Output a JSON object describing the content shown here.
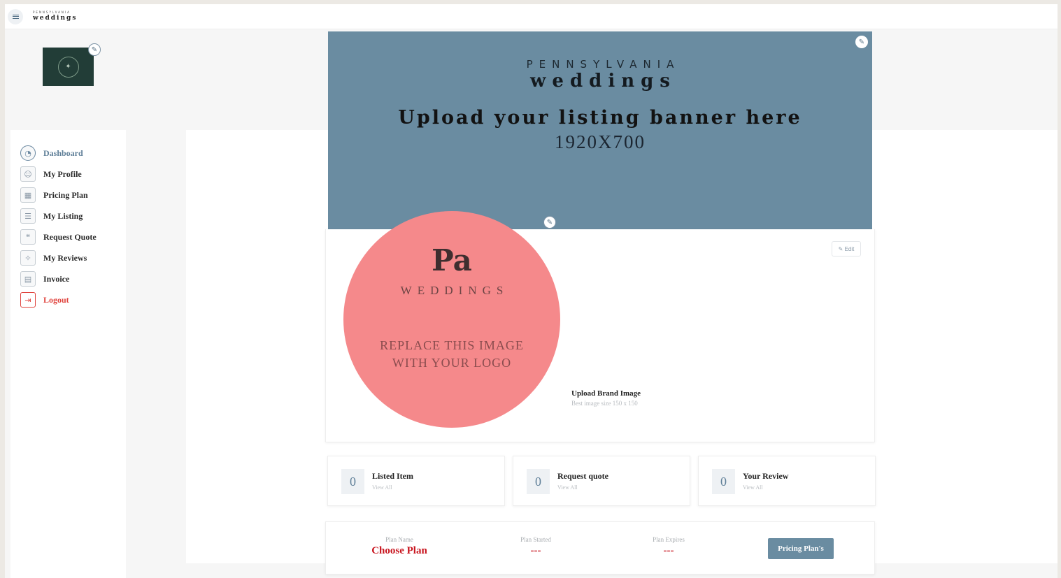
{
  "header": {
    "brand_small": "PENNSYLVANIA",
    "brand_big": "weddings",
    "menu_icon": "hamburger-icon"
  },
  "profile_logo": {
    "edit_icon": "pencil-icon"
  },
  "sidebar": {
    "items": [
      {
        "label": "Dashboard",
        "icon": "dashboard-gauge-icon",
        "active": true
      },
      {
        "label": "My Profile",
        "icon": "profile-icon"
      },
      {
        "label": "Pricing Plan",
        "icon": "pricing-table-icon"
      },
      {
        "label": "My Listing",
        "icon": "listing-icon"
      },
      {
        "label": "Request Quote",
        "icon": "quote-icon"
      },
      {
        "label": "My Reviews",
        "icon": "reviews-icon"
      },
      {
        "label": "Invoice",
        "icon": "invoice-icon"
      },
      {
        "label": "Logout",
        "icon": "logout-icon"
      }
    ]
  },
  "banner": {
    "state": "PENNSYLVANIA",
    "brand": "weddings",
    "upload_text": "Upload your listing banner here",
    "size_text": "1920X700",
    "background_color": "#6a8ca1"
  },
  "brand_logo": {
    "monogram": "Pa",
    "weddings": "WEDDINGS",
    "replace_line1": "REPLACE THIS IMAGE",
    "replace_line2": "WITH YOUR LOGO",
    "circle_color": "#f5898b"
  },
  "profile_card": {
    "edit_label": "✎ Edit",
    "upload_title": "Upload Brand Image",
    "upload_hint": "Best image size 150 x 150"
  },
  "stats": [
    {
      "value": "0",
      "label": "Listed Item",
      "link": "View All"
    },
    {
      "value": "0",
      "label": "Request quote",
      "link": "View All"
    },
    {
      "value": "0",
      "label": "Your Review",
      "link": "View All"
    }
  ],
  "plan": {
    "name_header": "Plan Name",
    "name_value": "Choose Plan",
    "started_header": "Plan Started",
    "started_value": "---",
    "expires_header": "Plan Expires",
    "expires_value": "---",
    "button_label": "Pricing Plan's",
    "accent_red": "#c8141e"
  }
}
